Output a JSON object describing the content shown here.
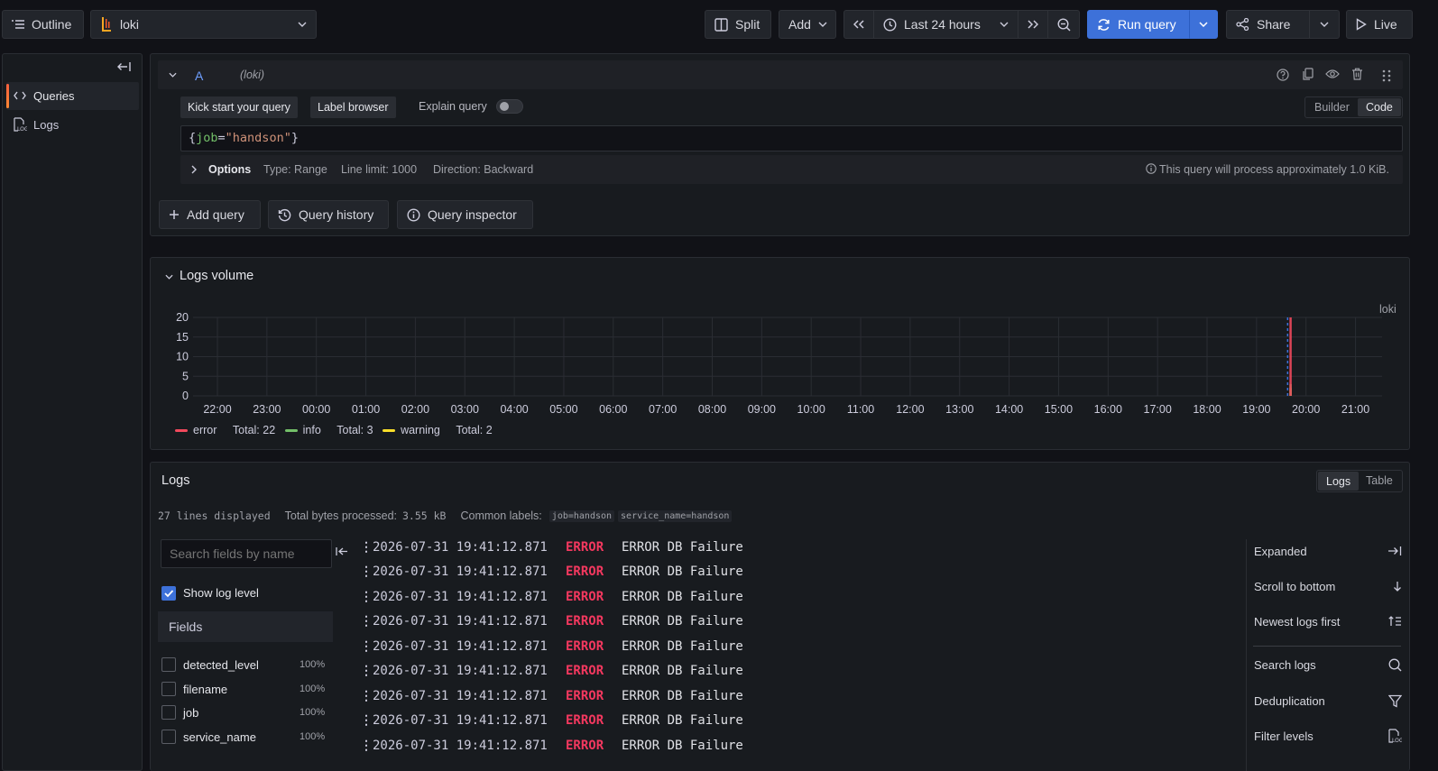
{
  "toolbar": {
    "outline_label": "Outline",
    "datasource": "loki",
    "split_label": "Split",
    "add_label": "Add",
    "time_range": "Last 24 hours",
    "run_query_label": "Run query",
    "share_label": "Share",
    "live_label": "Live"
  },
  "sidebar": {
    "items": [
      {
        "label": "Queries",
        "icon": "code-icon",
        "active": true
      },
      {
        "label": "Logs",
        "icon": "logs-icon",
        "active": false
      }
    ]
  },
  "query": {
    "ref_id": "A",
    "datasource_hint": "(loki)",
    "kick_start_label": "Kick start your query",
    "label_browser_label": "Label browser",
    "explain_label": "Explain query",
    "builder_label": "Builder",
    "code_label": "Code",
    "expression": {
      "open": "{",
      "key": "job",
      "eq": "=",
      "value": "\"handson\"",
      "close": "}"
    },
    "options_label": "Options",
    "type": "Type: Range",
    "line_limit": "Line limit: 1000",
    "direction": "Direction: Backward",
    "estimate": "This query will process approximately 1.0 KiB."
  },
  "query_actions": {
    "add_query": "Add query",
    "query_history": "Query history",
    "query_inspector": "Query inspector"
  },
  "logs_volume": {
    "title": "Logs volume",
    "datasource_label": "loki"
  },
  "chart_data": {
    "type": "bar",
    "yticks": [
      "20",
      "15",
      "10",
      "5",
      "0"
    ],
    "ylim": [
      0,
      20
    ],
    "xticks": [
      "22:00",
      "23:00",
      "00:00",
      "01:00",
      "02:00",
      "03:00",
      "04:00",
      "05:00",
      "06:00",
      "07:00",
      "08:00",
      "09:00",
      "10:00",
      "11:00",
      "12:00",
      "13:00",
      "14:00",
      "15:00",
      "16:00",
      "17:00",
      "18:00",
      "19:00",
      "20:00",
      "21:00"
    ],
    "series": [
      {
        "name": "error",
        "total_label": "Total: 22",
        "color": "#f2495c",
        "x": "19:41",
        "value": 22
      },
      {
        "name": "info",
        "total_label": "Total: 3",
        "color": "#73bf69",
        "x": "19:41",
        "value": 3
      },
      {
        "name": "warning",
        "total_label": "Total: 2",
        "color": "#fade2a",
        "x": "19:41",
        "value": 2
      }
    ],
    "grid": true,
    "legend": "bottom-left"
  },
  "logs": {
    "title": "Logs",
    "view_logs": "Logs",
    "view_table": "Table",
    "lines_displayed": "27 lines displayed",
    "bytes_label": "Total bytes processed:",
    "bytes_value": "3.55 kB",
    "common_labels_label": "Common labels:",
    "common_labels": [
      "job=handson",
      "service_name=handson"
    ],
    "search_placeholder": "Search fields by name",
    "show_log_level": "Show log level",
    "fields_header": "Fields",
    "fields": [
      {
        "name": "detected_level",
        "pct": "100%"
      },
      {
        "name": "filename",
        "pct": "100%"
      },
      {
        "name": "job",
        "pct": "100%"
      },
      {
        "name": "service_name",
        "pct": "100%"
      }
    ],
    "rows": [
      {
        "ts": "2026-07-31 19:41:12.871",
        "level": "ERROR",
        "msg": "ERROR DB Failure"
      },
      {
        "ts": "2026-07-31 19:41:12.871",
        "level": "ERROR",
        "msg": "ERROR DB Failure"
      },
      {
        "ts": "2026-07-31 19:41:12.871",
        "level": "ERROR",
        "msg": "ERROR DB Failure"
      },
      {
        "ts": "2026-07-31 19:41:12.871",
        "level": "ERROR",
        "msg": "ERROR DB Failure"
      },
      {
        "ts": "2026-07-31 19:41:12.871",
        "level": "ERROR",
        "msg": "ERROR DB Failure"
      },
      {
        "ts": "2026-07-31 19:41:12.871",
        "level": "ERROR",
        "msg": "ERROR DB Failure"
      },
      {
        "ts": "2026-07-31 19:41:12.871",
        "level": "ERROR",
        "msg": "ERROR DB Failure"
      },
      {
        "ts": "2026-07-31 19:41:12.871",
        "level": "ERROR",
        "msg": "ERROR DB Failure"
      },
      {
        "ts": "2026-07-31 19:41:12.871",
        "level": "ERROR",
        "msg": "ERROR DB Failure"
      }
    ],
    "options": [
      {
        "label": "Expanded",
        "icon": "arrow-right-to-line-icon"
      },
      {
        "label": "Scroll to bottom",
        "icon": "arrow-down-icon"
      },
      {
        "label": "Newest logs first",
        "icon": "sort-newest-icon"
      },
      {
        "label": "Search logs",
        "icon": "search-icon"
      },
      {
        "label": "Deduplication",
        "icon": "filter-icon"
      },
      {
        "label": "Filter levels",
        "icon": "logs-filter-icon"
      }
    ]
  }
}
